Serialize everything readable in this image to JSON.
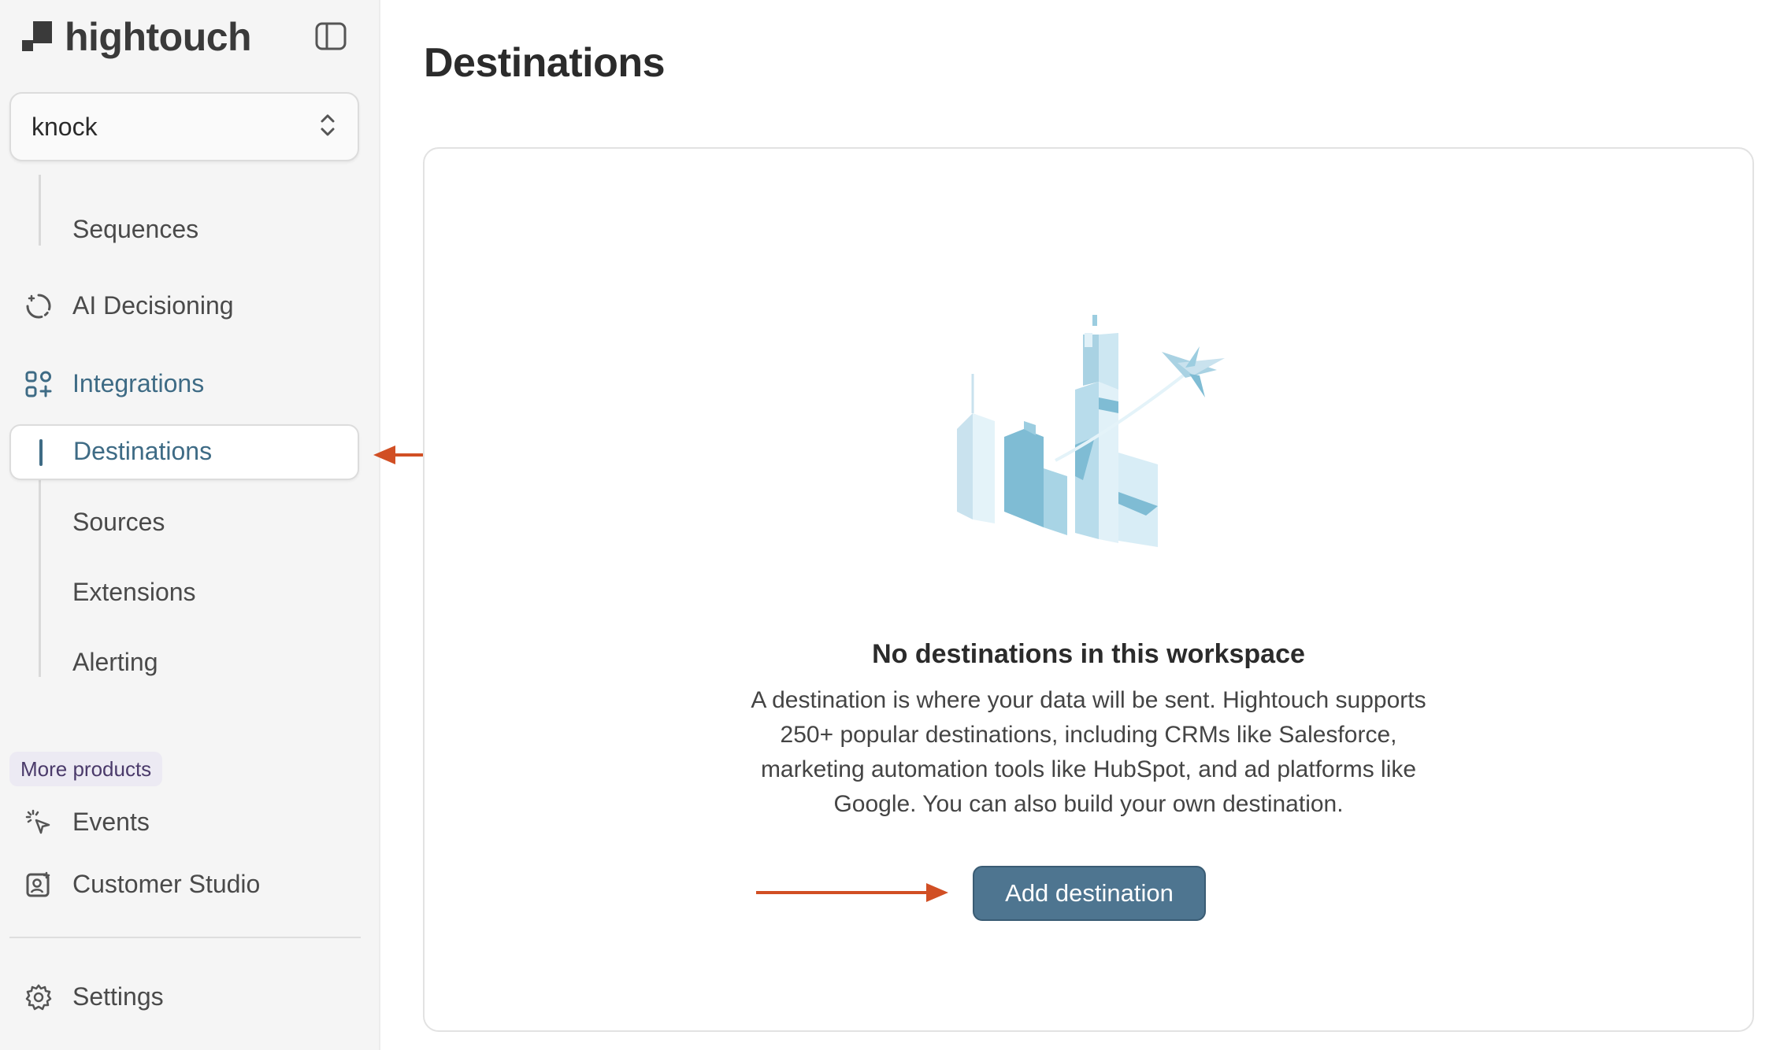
{
  "sidebar": {
    "brand": "hightouch",
    "workspace": "knock",
    "items": {
      "sequences": "Sequences",
      "ai_decisioning": "AI Decisioning",
      "integrations": "Integrations",
      "destinations": "Destinations",
      "sources": "Sources",
      "extensions": "Extensions",
      "alerting": "Alerting"
    },
    "more_products_label": "More products",
    "more": {
      "events": "Events",
      "customer_studio": "Customer Studio"
    },
    "settings": "Settings"
  },
  "main": {
    "title": "Destinations",
    "empty_title": "No destinations in this workspace",
    "empty_description": "A destination is where your data will be sent. Hightouch supports 250+ popular destinations, including CRMs like Salesforce, marketing automation tools like HubSpot, and ad platforms like Google. You can also build your own destination.",
    "add_button": "Add destination"
  },
  "colors": {
    "accent": "#3e6b85",
    "button": "#4e7590",
    "annotation_arrow": "#d14f24"
  }
}
